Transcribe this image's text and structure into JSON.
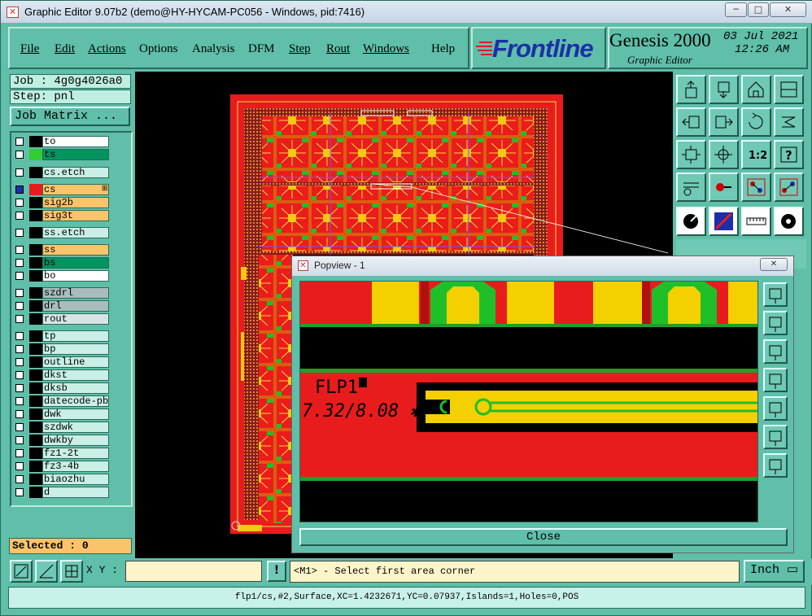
{
  "window": {
    "title": "Graphic Editor 9.07b2 (demo@HY-HYCAM-PC056 - Windows, pid:7416)",
    "minimize": "─",
    "maximize": "□",
    "close": "✕"
  },
  "menu": [
    {
      "label": "File"
    },
    {
      "label": "Edit"
    },
    {
      "label": "Actions"
    },
    {
      "label": "Options"
    },
    {
      "label": "Analysis"
    },
    {
      "label": "DFM"
    },
    {
      "label": "Step"
    },
    {
      "label": "Rout"
    },
    {
      "label": "Windows"
    },
    {
      "label": "Help"
    }
  ],
  "branding": {
    "logo": "Frontline",
    "product": "Genesis 2000",
    "subtitle": "Graphic Editor",
    "date": "03 Jul 2021",
    "time": "12:26 AM"
  },
  "job": {
    "job_label": "Job : 4g0g4026a0",
    "step_label": "Step: pnl",
    "matrix_button": "Job Matrix ..."
  },
  "layers": [
    {
      "name": "to",
      "color": "#ffffff",
      "swatch": "#000000"
    },
    {
      "name": "ts",
      "color": "#00945f",
      "swatch": "#33cc33"
    },
    {
      "name": "cs.etch",
      "color": "#c9efe6",
      "swatch": "#000000"
    },
    {
      "name": "cs",
      "color": "#fbc46a",
      "swatch": "#e81c1c",
      "active": true
    },
    {
      "name": "sig2b",
      "color": "#fbc46a",
      "swatch": "#000000"
    },
    {
      "name": "sig3t",
      "color": "#fbc46a",
      "swatch": "#000000"
    },
    {
      "name": "ss.etch",
      "color": "#c9efe6",
      "swatch": "#000000"
    },
    {
      "name": "ss",
      "color": "#fbc46a",
      "swatch": "#000000"
    },
    {
      "name": "bs",
      "color": "#00945f",
      "swatch": "#000000"
    },
    {
      "name": "bo",
      "color": "#ffffff",
      "swatch": "#000000"
    },
    {
      "name": "szdrl",
      "color": "#a9bdbd",
      "swatch": "#000000"
    },
    {
      "name": "drl",
      "color": "#a9bdbd",
      "swatch": "#000000"
    },
    {
      "name": "rout",
      "color": "#d8e4e4",
      "swatch": "#000000"
    },
    {
      "name": "tp",
      "color": "#c9efe6",
      "swatch": "#000000"
    },
    {
      "name": "bp",
      "color": "#c9efe6",
      "swatch": "#000000"
    },
    {
      "name": "outline",
      "color": "#c9efe6",
      "swatch": "#000000"
    },
    {
      "name": "dkst",
      "color": "#c9efe6",
      "swatch": "#000000"
    },
    {
      "name": "dksb",
      "color": "#c9efe6",
      "swatch": "#000000"
    },
    {
      "name": "datecode-pbe",
      "color": "#c9efe6",
      "swatch": "#000000"
    },
    {
      "name": "dwk",
      "color": "#c9efe6",
      "swatch": "#000000"
    },
    {
      "name": "szdwk",
      "color": "#c9efe6",
      "swatch": "#000000"
    },
    {
      "name": "dwkby",
      "color": "#c9efe6",
      "swatch": "#000000"
    },
    {
      "name": "fz1-2t",
      "color": "#c9efe6",
      "swatch": "#000000"
    },
    {
      "name": "fz3-4b",
      "color": "#c9efe6",
      "swatch": "#000000"
    },
    {
      "name": "biaozhu",
      "color": "#c9efe6",
      "swatch": "#000000"
    },
    {
      "name": "d",
      "color": "#c9efe6",
      "swatch": "#000000"
    }
  ],
  "selected": "Selected : 0",
  "popview": {
    "title": "Popview - 1",
    "close_label": "Close",
    "board_text_1": "FLP1",
    "board_text_2": "7.32/8.08 ✱"
  },
  "coords": {
    "xy_label": "X Y :",
    "xy_value": "",
    "prompt": "<M1> - Select first area corner",
    "units": "Inch"
  },
  "status": "flp1/cs,#2,Surface,XC=1.4232671,YC=0.07937,Islands=1,Holes=0,POS",
  "tools": [
    "zoom-home-icon",
    "zoom-in-icon",
    "home-icon",
    "zoom-window-icon",
    "pan-left-icon",
    "pan-right-icon",
    "undo-view-icon",
    "measure-icon",
    "fit-icon",
    "center-icon",
    "scale-icon",
    "help-icon",
    "snap-icon",
    "probe-icon",
    "net-icon",
    "connect-icon",
    "select-icon",
    "line-icon",
    "ruler-icon",
    "pad-icon"
  ],
  "popview_tools": [
    "zoom-view-icon",
    "pan-up-icon",
    "pan-down-icon",
    "pan-left-icon",
    "pan-right-icon",
    "fit-view-icon",
    "center-view-icon"
  ]
}
